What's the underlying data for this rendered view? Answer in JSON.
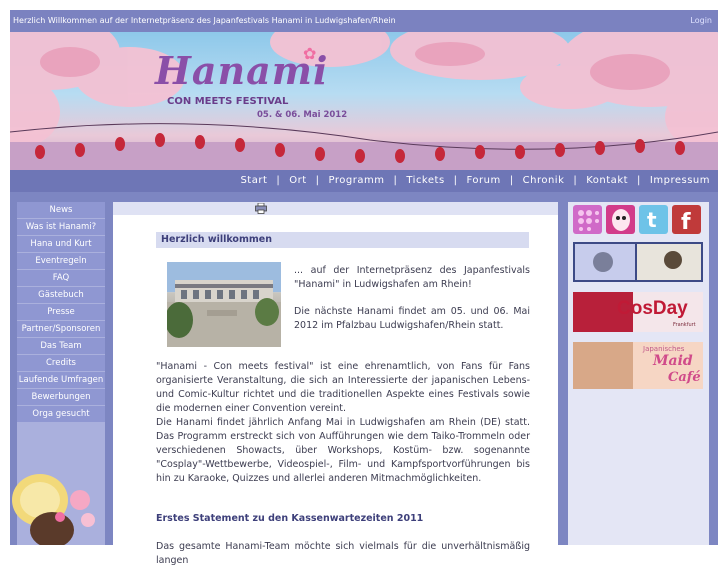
{
  "topbar": {
    "title": "Herzlich Willkommen auf der Internetpräsenz des Japanfestivals Hanami in Ludwigshafen/Rhein",
    "login": "Login"
  },
  "banner": {
    "logo": "Hanami",
    "tagline": "CON MEETS FESTIVAL",
    "date": "05. & 06. Mai 2012"
  },
  "nav": {
    "items": [
      "Start",
      "Ort",
      "Programm",
      "Tickets",
      "Forum",
      "Chronik",
      "Kontakt",
      "Impressum"
    ]
  },
  "sidebar": {
    "items": [
      "News",
      "Was ist Hanami?",
      "Hana und Kurt",
      "Eventregeln",
      "FAQ",
      "Gästebuch",
      "Presse",
      "Partner/Sponsoren",
      "Das Team",
      "Credits",
      "Laufende Umfragen",
      "Bewerbungen",
      "Orga gesucht"
    ]
  },
  "content": {
    "heading": "Herzlich willkommen",
    "intro1": "... auf der Internetpräsenz des Japanfestivals \"Hanami\" in Ludwigshafen am Rhein!",
    "intro2": "Die nächste Hanami findet am 05. und 06. Mai 2012 im Pfalzbau Ludwigshafen/Rhein statt.",
    "body1": "\"Hanami - Con meets festival\" ist eine ehrenamtlich, von Fans für Fans organisierte Veranstaltung, die sich an Interessierte der japanischen Lebens- und Comic-Kultur richtet und die traditionellen Aspekte eines Festivals sowie die modernen einer Convention vereint.",
    "body2": "Die Hanami findet jährlich Anfang Mai in Ludwigshafen am Rhein (DE) statt. Das Programm erstreckt sich von Aufführungen wie dem Taiko-Trommeln oder verschiedenen Showacts, über Workshops, Kostüm- bzw. sogenannte \"Cosplay\"-Wettbewerbe, Videospiel-, Film- und Kampfsportvorführungen bis hin zu Karaoke, Quizzes und allerlei anderen Mitmachmöglichkeiten.",
    "statement_title": "Erstes Statement zu den Kassenwartezeiten 2011",
    "statement_text": "Das gesamte Hanami-Team möchte sich vielmals für die unverhältnismäßig langen"
  },
  "right": {
    "social": [
      "myspace-icon",
      "animexx-icon",
      "twitter-icon",
      "facebook-icon"
    ],
    "cosday": {
      "title": "CosDay",
      "sub": "Frankfurt"
    },
    "maid": {
      "line1": "Japanisches",
      "line2": "Maid",
      "line3": "Café"
    }
  },
  "colors": {
    "frame": "#7d86c2",
    "nav": "#6e76b6",
    "sidebar_item": "#8f97d2",
    "heading_bg": "#d7dbf0",
    "heading_text": "#3d3f7a"
  }
}
